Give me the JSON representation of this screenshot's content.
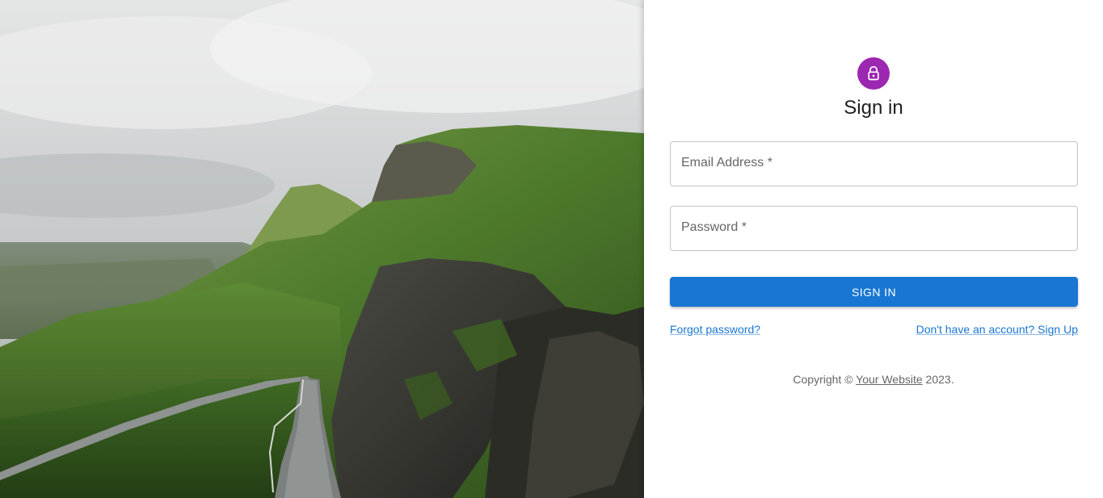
{
  "hero": {
    "image": "mountain-landscape"
  },
  "form": {
    "icon": "lock-icon",
    "title": "Sign in",
    "email_label": "Email Address *",
    "email_value": "",
    "password_label": "Password *",
    "password_value": "",
    "submit_label": "SIGN IN",
    "forgot_link": "Forgot password?",
    "signup_link": "Don't have an account? Sign Up"
  },
  "footer": {
    "prefix": "Copyright © ",
    "site_link": "Your Website",
    "suffix": " 2023."
  },
  "colors": {
    "avatar": "#9c27b0",
    "primary": "#1976d2",
    "muted_text": "#666666"
  }
}
